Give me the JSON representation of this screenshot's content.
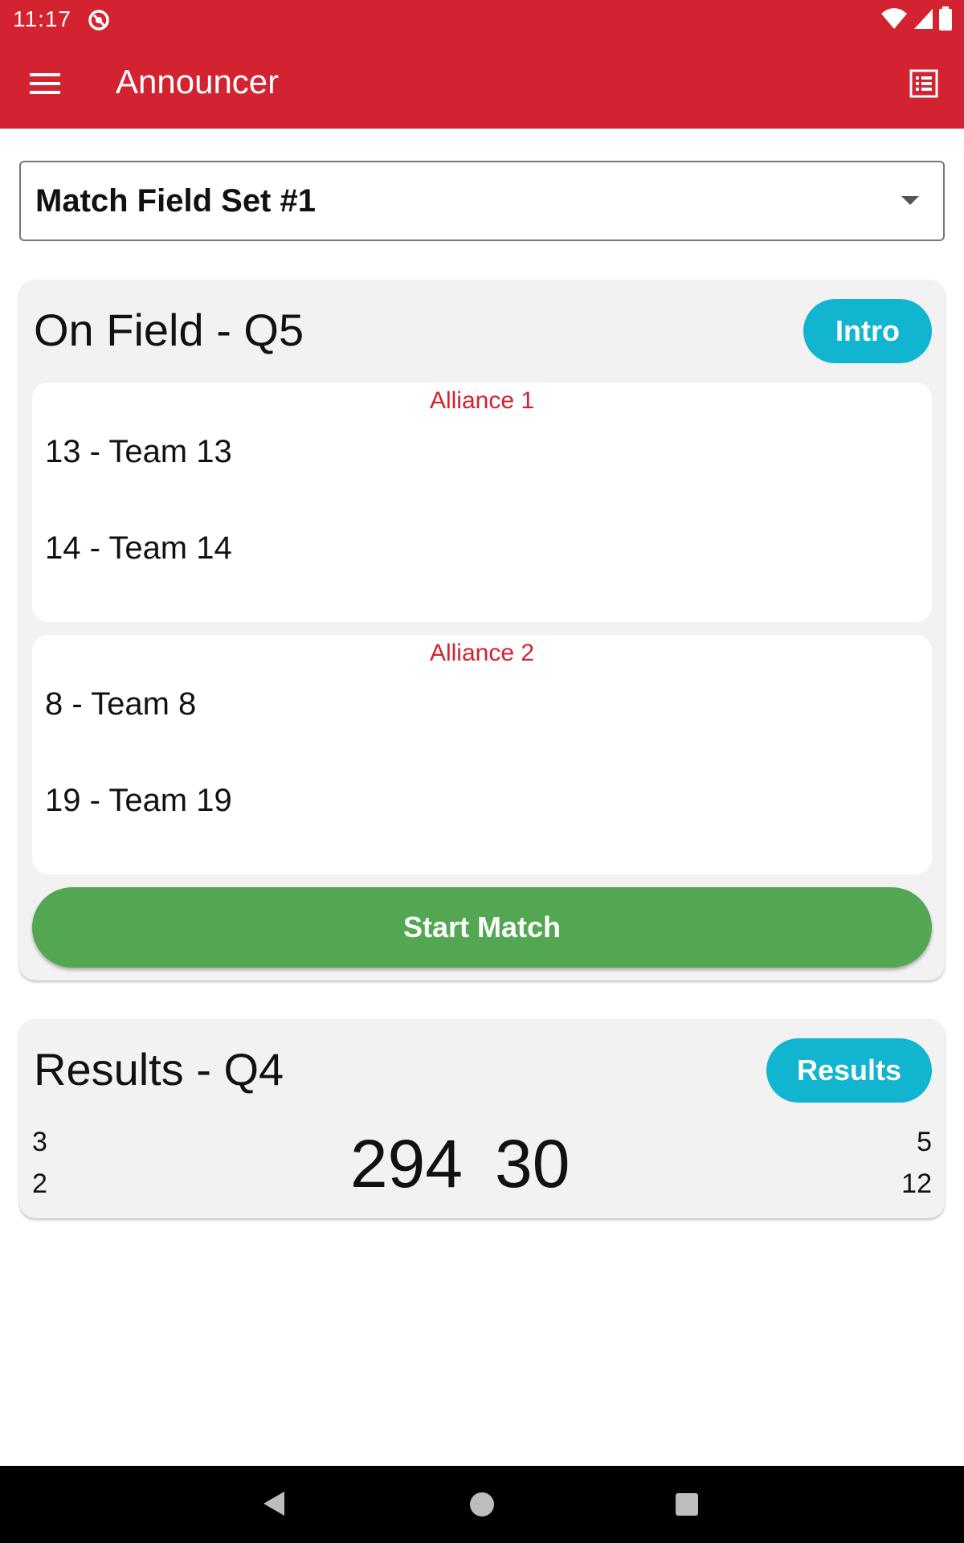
{
  "status_bar": {
    "time": "11:17",
    "icons": [
      "app-notification-icon",
      "wifi-icon",
      "signal-icon",
      "battery-icon"
    ]
  },
  "app_bar": {
    "title": "Announcer",
    "color": "#d32230",
    "menu_icon": "hamburger-menu-icon",
    "action_icon": "list-view-icon"
  },
  "field_set_select": {
    "selected": "Match Field Set #1"
  },
  "on_field": {
    "title": "On Field - Q5",
    "intro_label": "Intro",
    "alliances": [
      {
        "label": "Alliance 1",
        "teams": [
          "13 - Team 13",
          "14 - Team 14"
        ]
      },
      {
        "label": "Alliance 2",
        "teams": [
          "8 - Team 8",
          "19 - Team 19"
        ]
      }
    ],
    "start_label": "Start Match",
    "start_color": "#53a752",
    "button_color": "#11b5cf"
  },
  "results": {
    "title": "Results - Q4",
    "button_label": "Results",
    "left_ranks": [
      "3",
      "2"
    ],
    "right_ranks": [
      "5",
      "12"
    ],
    "left_score": "294",
    "right_score": "30"
  },
  "nav_bar": {
    "icons": [
      "back-icon",
      "home-icon",
      "recents-icon"
    ]
  }
}
